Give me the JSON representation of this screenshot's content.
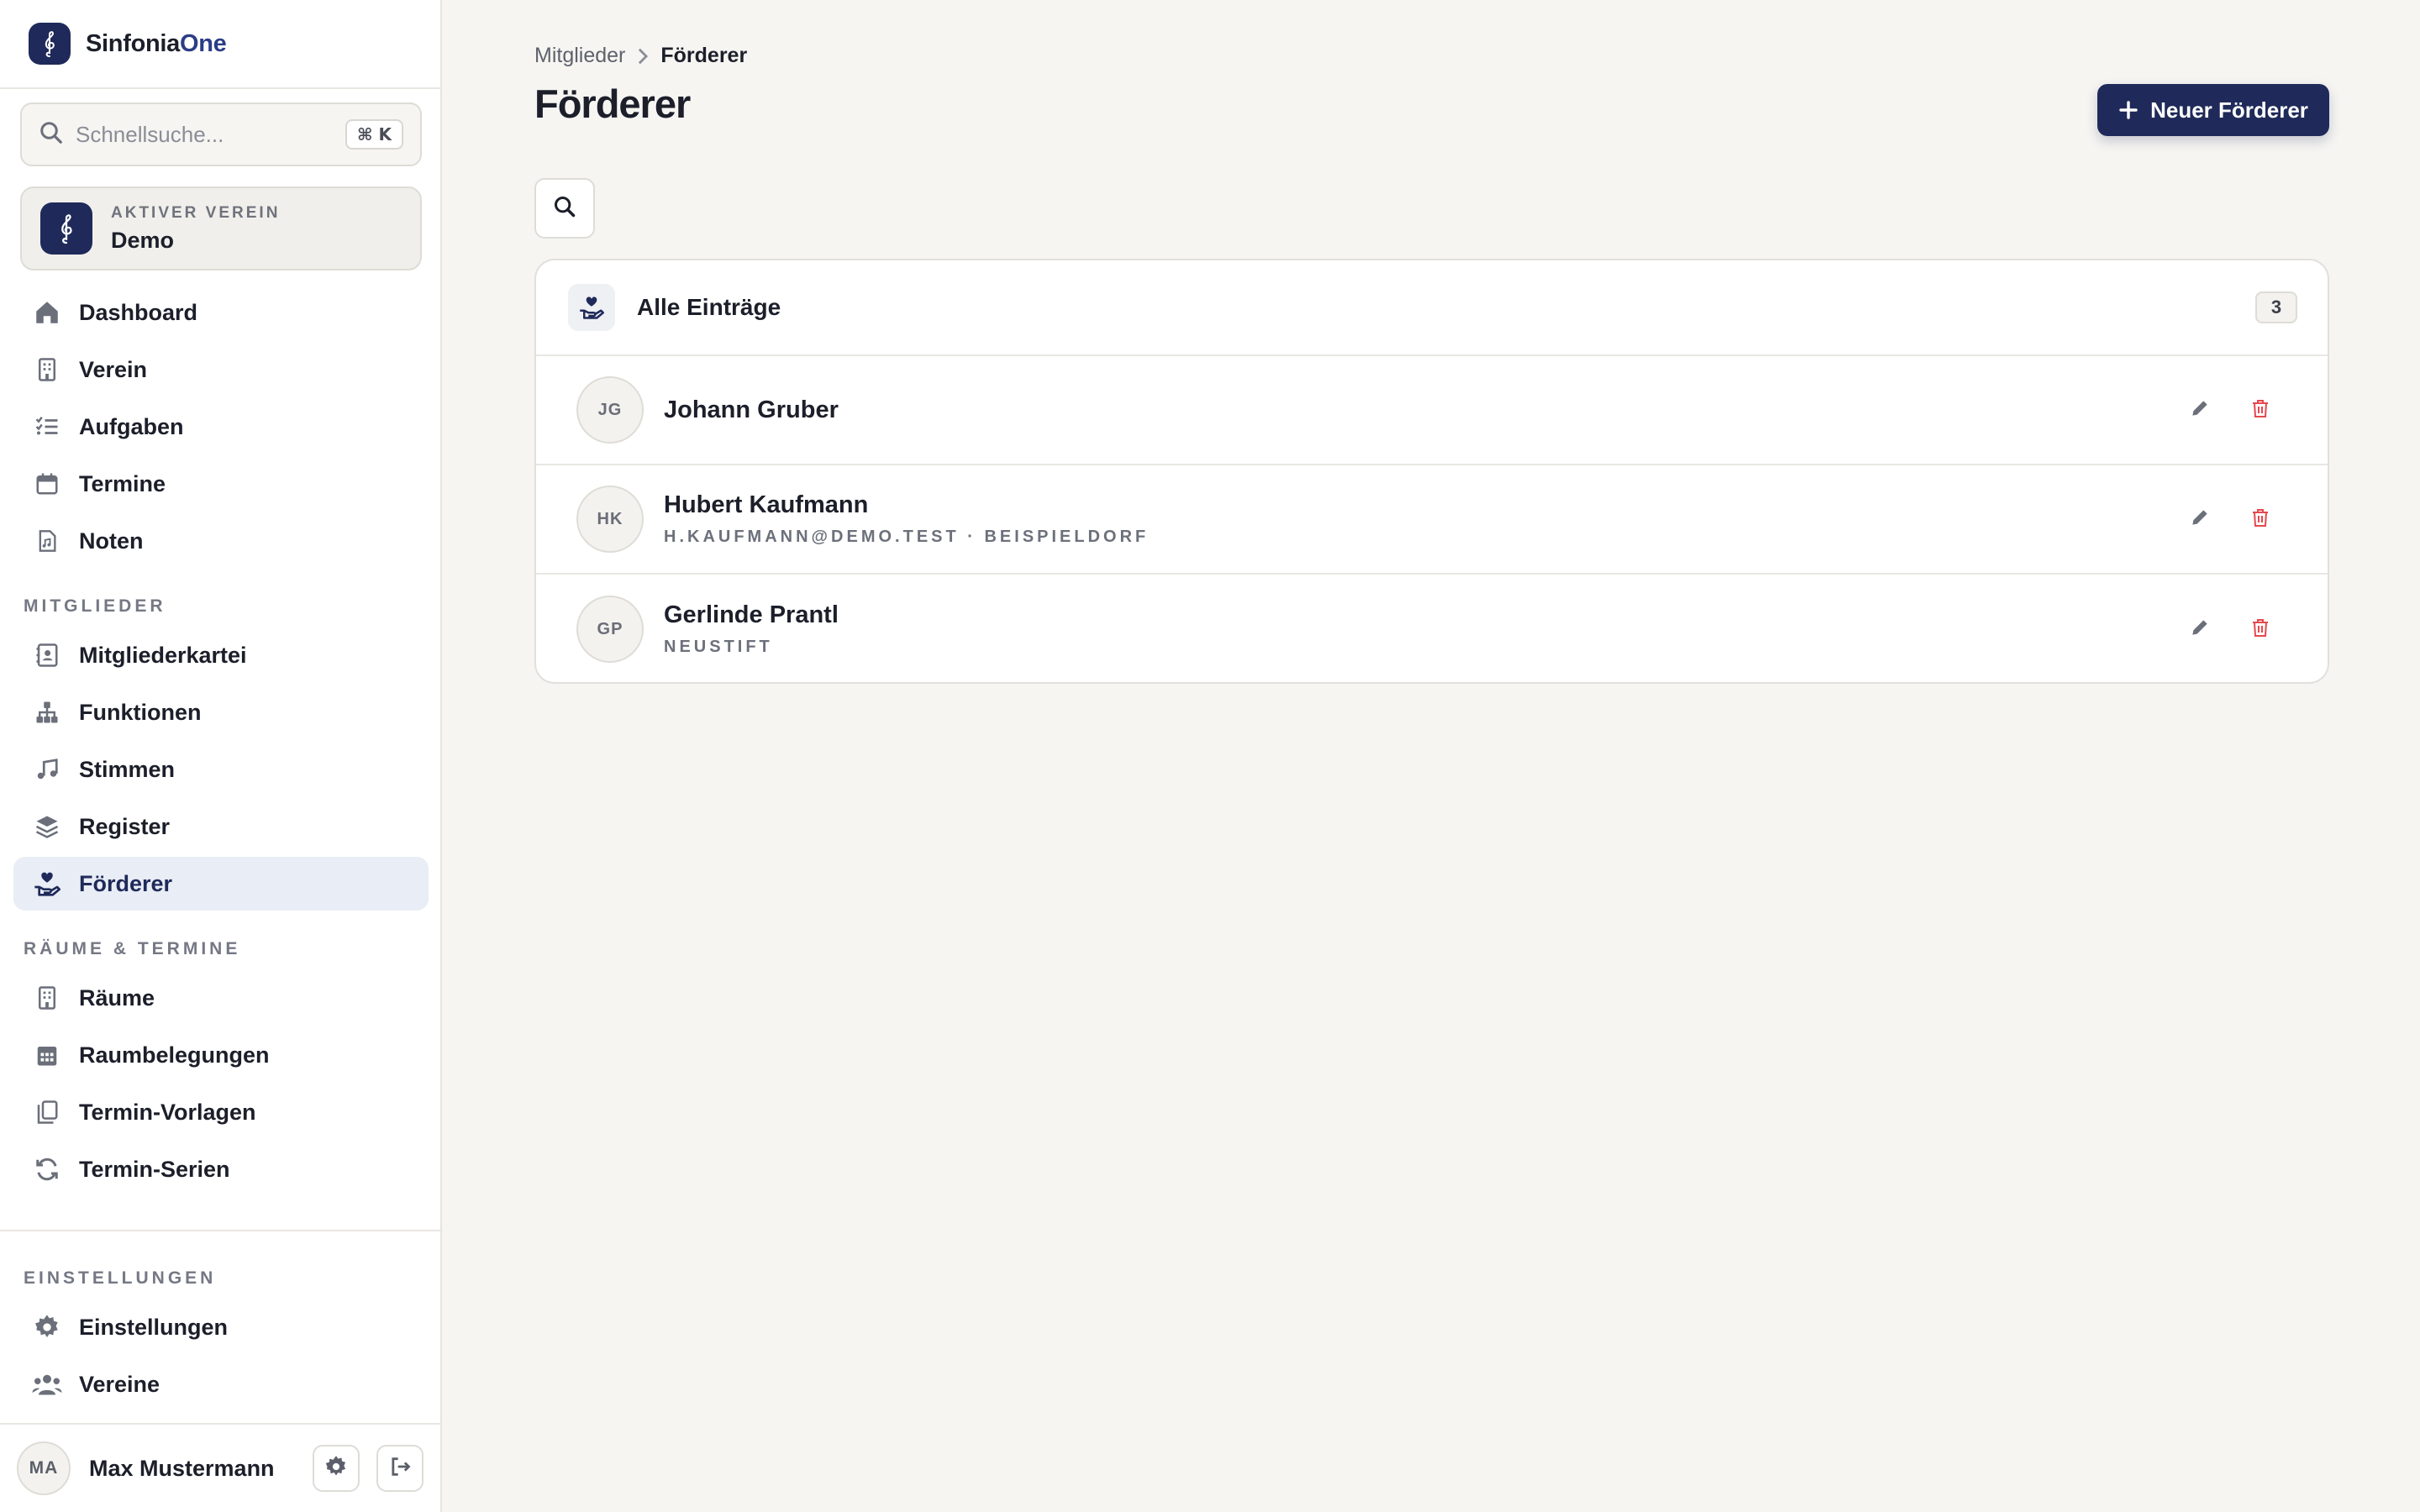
{
  "app": {
    "name_part1": "Sinfonia",
    "name_part2": "One"
  },
  "search": {
    "placeholder": "Schnellsuche...",
    "shortcut": "⌘ K"
  },
  "active_club": {
    "eyebrow": "AKTIVER VEREIN",
    "name": "Demo"
  },
  "nav": {
    "main": [
      {
        "label": "Dashboard",
        "icon": "home-icon"
      },
      {
        "label": "Verein",
        "icon": "building-icon"
      },
      {
        "label": "Aufgaben",
        "icon": "list-check-icon"
      },
      {
        "label": "Termine",
        "icon": "calendar-icon"
      },
      {
        "label": "Noten",
        "icon": "sheet-music-file-icon"
      }
    ],
    "section_members": "MITGLIEDER",
    "members": [
      {
        "label": "Mitgliederkartei",
        "icon": "contact-card-icon"
      },
      {
        "label": "Funktionen",
        "icon": "hierarchy-icon"
      },
      {
        "label": "Stimmen",
        "icon": "music-note-icon"
      },
      {
        "label": "Register",
        "icon": "layers-icon"
      },
      {
        "label": "Förderer",
        "icon": "hand-heart-icon",
        "active": true
      }
    ],
    "section_rooms": "RÄUME & TERMINE",
    "rooms": [
      {
        "label": "Räume",
        "icon": "building-icon"
      },
      {
        "label": "Raumbelegungen",
        "icon": "calendar-grid-icon"
      },
      {
        "label": "Termin-Vorlagen",
        "icon": "copy-icon"
      },
      {
        "label": "Termin-Serien",
        "icon": "refresh-icon"
      }
    ],
    "section_settings": "EINSTELLUNGEN",
    "settings": [
      {
        "label": "Einstellungen",
        "icon": "gear-icon"
      },
      {
        "label": "Vereine",
        "icon": "users-icon"
      }
    ]
  },
  "user": {
    "initials": "MA",
    "name": "Max Mustermann"
  },
  "breadcrumb": {
    "parent": "Mitglieder",
    "current": "Förderer"
  },
  "page": {
    "title": "Förderer",
    "new_button": "Neuer Förderer"
  },
  "list": {
    "title": "Alle Einträge",
    "count": "3",
    "rows": [
      {
        "initials": "JG",
        "name": "Johann Gruber",
        "sub": ""
      },
      {
        "initials": "HK",
        "name": "Hubert Kaufmann",
        "sub": "h.kaufmann@demo.test · Beispieldorf"
      },
      {
        "initials": "GP",
        "name": "Gerlinde Prantl",
        "sub": "Neustift"
      }
    ]
  },
  "colors": {
    "brand": "#1f2a5a",
    "danger": "#e5484d",
    "background": "#f6f5f2"
  }
}
